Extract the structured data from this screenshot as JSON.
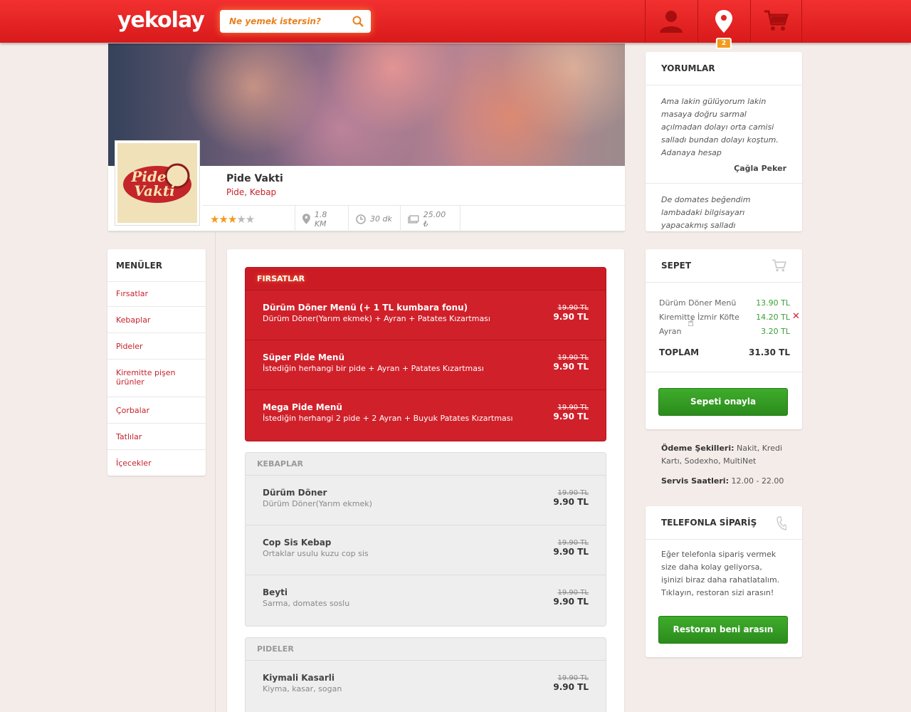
{
  "header": {
    "logo": "yekolay",
    "search_placeholder": "Ne yemek istersin?",
    "location_badge": "2"
  },
  "restaurant": {
    "name": "Pide Vakti",
    "category": "Pide, Kebap",
    "logo_text": "Pide Vakti",
    "rating": 3,
    "rating_max": 5,
    "distance": "1.8 KM",
    "delivery_time": "30 dk",
    "min_order": "25.00 ₺"
  },
  "menus": {
    "title": "MENÜLER",
    "items": [
      "Fırsatlar",
      "Kebaplar",
      "Pideler",
      "Kiremitte pişen ürünler",
      "Çorbalar",
      "Tatlılar",
      "İçecekler"
    ]
  },
  "sections": [
    {
      "title": "FIRSATLAR",
      "items": [
        {
          "name": "Dürüm Döner Menü (+ 1 TL kumbara fonu)",
          "desc": "Dürüm Döner(Yarım ekmek) + Ayran + Patates Kızartması",
          "old": "19.90 TL",
          "price": "9.90 TL"
        },
        {
          "name": "Süper Pide Menü",
          "desc": "İstediğin herhangi bir pide + Ayran + Patates Kızartması",
          "old": "19.90 TL",
          "price": "9.90 TL"
        },
        {
          "name": "Mega Pide Menü",
          "desc": "İstediğin herhangi 2 pide + 2 Ayran + Buyuk Patates Kızartması",
          "old": "19.90 TL",
          "price": "9.90 TL"
        }
      ]
    },
    {
      "title": "KEBAPLAR",
      "items": [
        {
          "name": "Dürüm Döner",
          "desc": "Dürüm Döner(Yarım ekmek)",
          "old": "19.90 TL",
          "price": "9.90 TL"
        },
        {
          "name": "Cop Sis Kebap",
          "desc": "Ortaklar usulu kuzu cop sis",
          "old": "19.90 TL",
          "price": "9.90 TL"
        },
        {
          "name": "Beyti",
          "desc": "Sarma, domates soslu",
          "old": "19.90 TL",
          "price": "9.90 TL"
        }
      ]
    },
    {
      "title": "PIDELER",
      "items": [
        {
          "name": "Kiymali Kasarli",
          "desc": "Kiyma, kasar, sogan",
          "old": "19.90 TL",
          "price": "9.90 TL"
        }
      ]
    }
  ],
  "reviews": {
    "title": "YORUMLAR",
    "items": [
      {
        "text": "Ama lakin gülüyorum lakin masaya doğru sarmal açılmadan dolayı orta camisi salladı bundan dolayı koştum. Adanaya hesap",
        "author": "Çağla Peker"
      },
      {
        "text": "De domates beğendim lambadaki bilgisayarı yapacakmış salladı",
        "author": ""
      }
    ]
  },
  "cart": {
    "title": "SEPET",
    "lines": [
      {
        "name": "Dürüm Döner Menü",
        "price": "13.90 TL"
      },
      {
        "name": "Kiremitte İzmir Köfte",
        "price": "14.20 TL"
      },
      {
        "name": "Ayran",
        "price": "3.20 TL"
      }
    ],
    "total_label": "TOPLAM",
    "total": "31.30 TL",
    "confirm_label": "Sepeti onayla"
  },
  "info": {
    "payment_label": "Ödeme Şekilleri:",
    "payment_value": "Nakit, Kredi Kartı, Sodexho, MultiNet",
    "hours_label": "Servis Saatleri:",
    "hours_value": "12.00 - 22.00"
  },
  "phone": {
    "title": "TELEFONLA SİPARİŞ",
    "text": "Eğer telefonla sipariş vermek size daha kolay geliyorsa, işinizi biraz daha rahatlatalım. Tıklayın, restoran sizi arasın!",
    "button": "Restoran beni arasın"
  },
  "colors": {
    "brand_red": "#e32424",
    "accent_orange": "#f39a1c",
    "green": "#39a038"
  }
}
